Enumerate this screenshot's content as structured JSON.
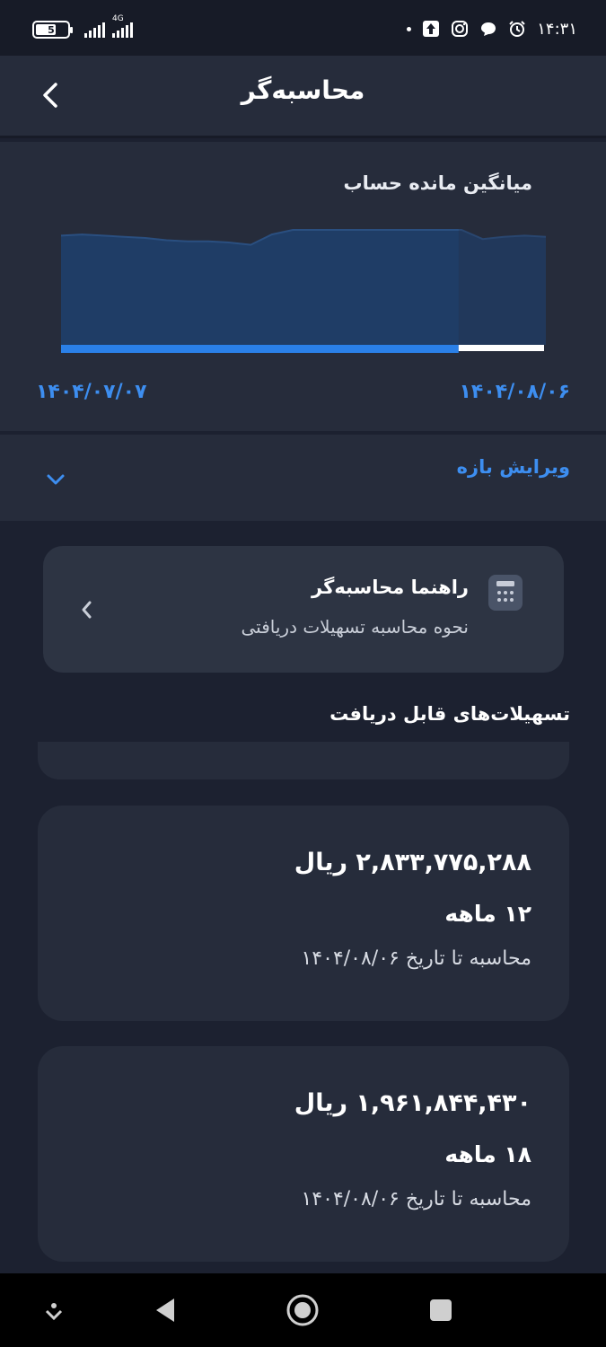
{
  "status_bar": {
    "battery": "5",
    "network": "4G",
    "time": "۱۴:۳۱"
  },
  "app_bar": {
    "title": "محاسبه‌گر"
  },
  "chart_data": {
    "type": "area",
    "title": "میانگین مانده حساب",
    "x_start_label": "۱۴۰۴/۰۷/۰۷",
    "x_end_label": "۱۴۰۴/۰۸/۰۶",
    "values": [
      0.95,
      0.96,
      0.95,
      0.94,
      0.93,
      0.91,
      0.9,
      0.9,
      0.89,
      0.87,
      0.96,
      1.0,
      1.0,
      1.0,
      1.0,
      1.0,
      1.0,
      1.0,
      1.0,
      1.0,
      0.92,
      0.94,
      0.95,
      0.94
    ],
    "selected_fraction": 0.82,
    "colors": {
      "fill": "#1f3d66",
      "selected_bar": "#2a80e8",
      "unselected_bar": "#ffffff"
    }
  },
  "range": {
    "label": "ویرایش بازه"
  },
  "guide": {
    "title": "راهنما محاسبه‌گر",
    "subtitle": "نحوه محاسبه تسهیلات دریافتی"
  },
  "loans": {
    "section_title": "تسهیلات‌های قابل دریافت",
    "items": [
      {
        "amount": "۲,۸۳۳,۷۷۵,۲۸۸ ریال",
        "term": "۱۲ ماهه",
        "date": "محاسبه تا تاریخ ۱۴۰۴/۰۸/۰۶"
      },
      {
        "amount": "۱,۹۶۱,۸۴۴,۴۳۰ ریال",
        "term": "۱۸ ماهه",
        "date": "محاسبه تا تاریخ ۱۴۰۴/۰۸/۰۶"
      }
    ]
  },
  "colors": {
    "accent": "#3d8ef0",
    "background": "#1c2130",
    "card": "#262c3b"
  }
}
